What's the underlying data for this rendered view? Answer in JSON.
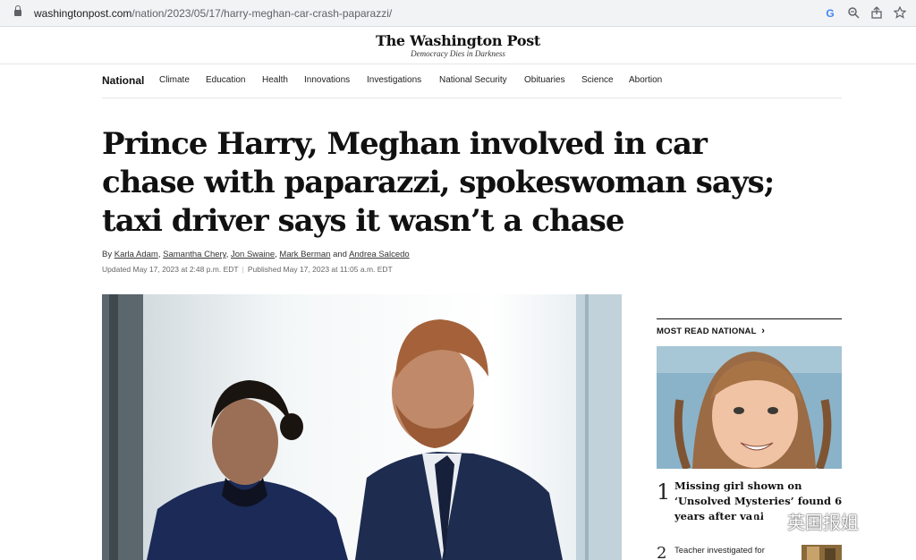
{
  "browser": {
    "url_host": "washingtonpost.com",
    "url_path": "/nation/2023/05/17/harry-meghan-car-crash-paparazzi/"
  },
  "masthead": {
    "logo": "The Washington Post",
    "tagline": "Democracy Dies in Darkness"
  },
  "nav": {
    "items": [
      {
        "label": "National"
      },
      {
        "label": "Climate"
      },
      {
        "label": "Education"
      },
      {
        "label": "Health"
      },
      {
        "label": "Innovations"
      },
      {
        "label": "Investigations"
      },
      {
        "label": "National Security"
      },
      {
        "label": "Obituaries"
      },
      {
        "label": "Science"
      },
      {
        "label": "Abortion"
      }
    ]
  },
  "article": {
    "headline_lines": [
      "Prince Harry, Meghan involved in car",
      "chase with paparazzi, spokeswoman says;",
      "taxi driver says it wasn’t a chase"
    ],
    "byline_prefix": "By",
    "authors": [
      "Karla Adam",
      "Samantha Chery",
      "Jon Swaine",
      "Mark Berman",
      "Andrea Salcedo"
    ],
    "byline_and": "and",
    "updated": "Updated May 17, 2023 at 2:48 p.m. EDT",
    "published": "Published May 17, 2023 at 11:05 a.m. EDT"
  },
  "sidebar": {
    "title": "MOST READ NATIONAL",
    "chevron": "›",
    "stories": [
      {
        "rank": "1",
        "title_lines": [
          "Missing girl shown on",
          "‘Unsolved Mysteries’ found 6",
          "years after vani"
        ]
      },
      {
        "rank": "2",
        "title": "Teacher investigated for"
      }
    ]
  },
  "watermark": {
    "text": "英国报姐"
  },
  "icons": [
    "lock-icon",
    "google-icon",
    "zoom-icon",
    "share-icon",
    "star-icon",
    "chevron-right-icon"
  ],
  "colors": {
    "text": "#111111",
    "rule": "#e6e6e6",
    "url": "#5f6368"
  }
}
